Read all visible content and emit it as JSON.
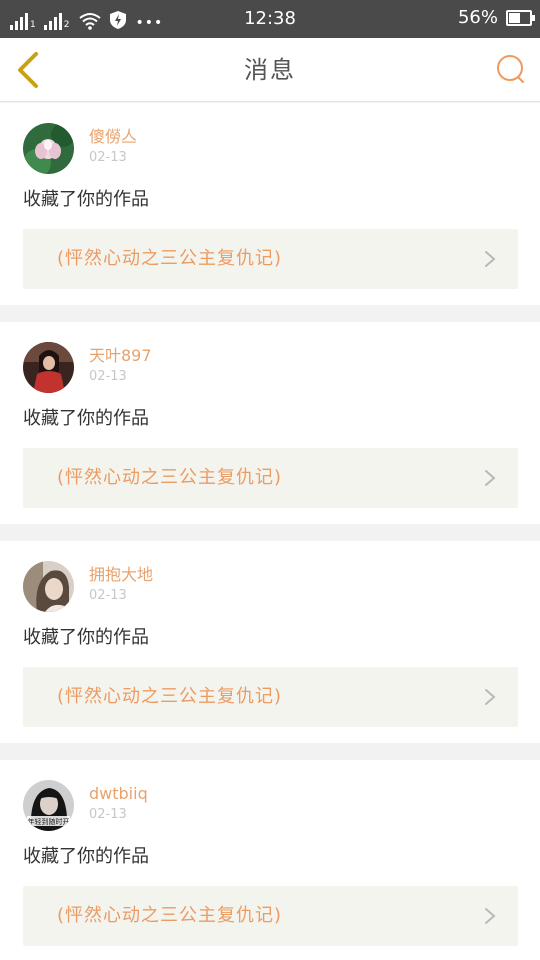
{
  "status_bar": {
    "sim1": "1",
    "sim2": "2",
    "time": "12:38",
    "battery_level": 0.56,
    "battery": "56%"
  },
  "nav": {
    "title": "消息"
  },
  "messages": [
    {
      "username": "傻僗亼",
      "date": "02-13",
      "action": "收藏了你的作品",
      "work": "(怦然心动之三公主复仇记)"
    },
    {
      "username": "天叶897",
      "date": "02-13",
      "action": "收藏了你的作品",
      "work": "(怦然心动之三公主复仇记)"
    },
    {
      "username": "拥抱大地",
      "date": "02-13",
      "action": "收藏了你的作品",
      "work": "(怦然心动之三公主复仇记)"
    },
    {
      "username": "dwtbiiq",
      "date": "02-13",
      "action": "收藏了你的作品",
      "work": "(怦然心动之三公主复仇记)"
    }
  ],
  "avatar_4_caption": "年轻到随时开",
  "colors": {
    "accent": "#e9a26c",
    "link_text": "#ec9b63",
    "status_bar_bg": "#4a4a4a",
    "card_link_bg": "#f4f4ee",
    "back_icon": "#c8a214"
  }
}
